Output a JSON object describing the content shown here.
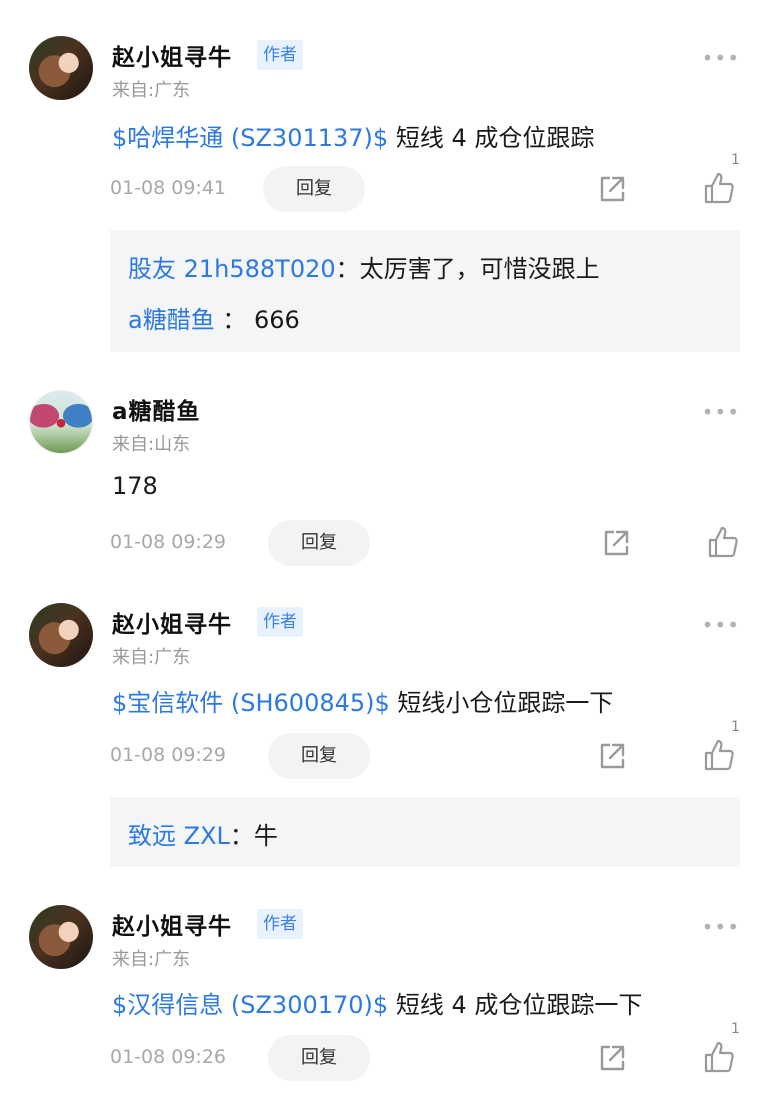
{
  "comments": [
    {
      "user": "赵小姐寻牛",
      "badge": "作者",
      "location": "来自:广东",
      "stock": "$哈焊华通 (SZ301137)$",
      "text": " 短线 4 成仓位跟踪",
      "time": "01-08 09:41",
      "reply_label": "回复",
      "likes": "1",
      "replies": [
        {
          "user": "股友 21h588T020",
          "sep": "：",
          "text": "太厉害了，可惜没跟上"
        },
        {
          "user": "a糖醋鱼",
          "sep": " ：",
          "text": " 666"
        }
      ]
    },
    {
      "user": "a糖醋鱼",
      "location": "来自:山东",
      "text": "178",
      "time": "01-08 09:29",
      "reply_label": "回复"
    },
    {
      "user": "赵小姐寻牛",
      "badge": "作者",
      "location": "来自:广东",
      "stock": "$宝信软件 (SH600845)$",
      "text": " 短线小仓位跟踪一下",
      "time": "01-08 09:29",
      "reply_label": "回复",
      "likes": "1",
      "replies": [
        {
          "user": "致远 ZXL",
          "sep": "：",
          "text": "牛"
        }
      ]
    },
    {
      "user": "赵小姐寻牛",
      "badge": "作者",
      "location": "来自:广东",
      "stock": "$汉得信息 (SZ300170)$",
      "text": " 短线 4 成仓位跟踪一下",
      "time": "01-08 09:26",
      "reply_label": "回复",
      "likes": "1"
    }
  ],
  "icons": {
    "more": "more-icon",
    "share": "share-icon",
    "like": "thumbs-up-icon"
  },
  "colors": {
    "link": "#2c78e4",
    "badge_bg": "#e8f1fe",
    "badge_text": "#3a82e8",
    "reply_bg": "#f4f5f7"
  }
}
